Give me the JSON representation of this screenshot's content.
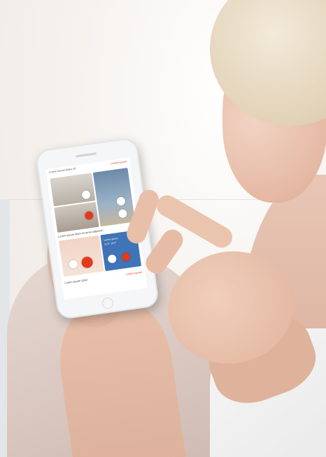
{
  "scene": {
    "subject": "woman holding smartphone with home-automation app"
  },
  "app": {
    "header_title": "Lorem ipsum dolor sit",
    "header_link": "Lorem ipsum",
    "section_label": "Lorem ipsum dolor sit amet adipiscin",
    "climate_line1": "Lorem ipsum",
    "climate_line2": "21.5°  19.0°",
    "footer_label": "Lorem ipsum dolor",
    "footer_link": "Lorem ipsum",
    "accent_color": "#e23a1f",
    "climate_tile_color": "#3f74b8"
  }
}
